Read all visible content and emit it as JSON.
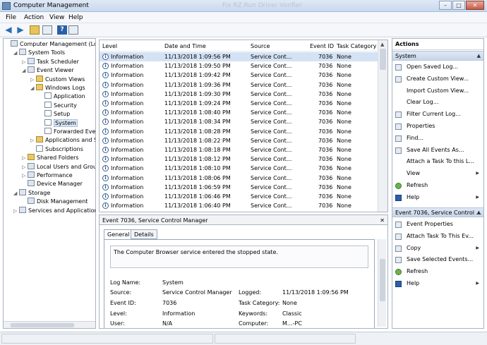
{
  "window": {
    "title": "Computer Management",
    "ghost_title": "Fix RZ Run Driver Verifier"
  },
  "menu": {
    "items": [
      "File",
      "Action",
      "View",
      "Help"
    ]
  },
  "tree": {
    "items": [
      {
        "label": "Computer Management (Local",
        "level": 0,
        "exp": "",
        "icon": "computer"
      },
      {
        "label": "System Tools",
        "level": 1,
        "exp": "◢",
        "icon": "tools"
      },
      {
        "label": "Task Scheduler",
        "level": 2,
        "exp": "▷",
        "icon": "clock"
      },
      {
        "label": "Event Viewer",
        "level": 2,
        "exp": "◢",
        "icon": "viewer"
      },
      {
        "label": "Custom Views",
        "level": 3,
        "exp": "▷",
        "icon": "folder"
      },
      {
        "label": "Windows Logs",
        "level": 3,
        "exp": "◢",
        "icon": "folder"
      },
      {
        "label": "Application",
        "level": 4,
        "exp": "",
        "icon": "log"
      },
      {
        "label": "Security",
        "level": 4,
        "exp": "",
        "icon": "log"
      },
      {
        "label": "Setup",
        "level": 4,
        "exp": "",
        "icon": "log"
      },
      {
        "label": "System",
        "level": 4,
        "exp": "",
        "icon": "log",
        "selected": true
      },
      {
        "label": "Forwarded Event",
        "level": 4,
        "exp": "",
        "icon": "log"
      },
      {
        "label": "Applications and Se",
        "level": 3,
        "exp": "▷",
        "icon": "folder"
      },
      {
        "label": "Subscriptions",
        "level": 3,
        "exp": "",
        "icon": "log"
      },
      {
        "label": "Shared Folders",
        "level": 2,
        "exp": "▷",
        "icon": "folder"
      },
      {
        "label": "Local Users and Groups",
        "level": 2,
        "exp": "▷",
        "icon": "users"
      },
      {
        "label": "Performance",
        "level": 2,
        "exp": "▷",
        "icon": "perf"
      },
      {
        "label": "Device Manager",
        "level": 2,
        "exp": "",
        "icon": "device"
      },
      {
        "label": "Storage",
        "level": 1,
        "exp": "◢",
        "icon": "storage"
      },
      {
        "label": "Disk Management",
        "level": 2,
        "exp": "",
        "icon": "disk"
      },
      {
        "label": "Services and Applications",
        "level": 1,
        "exp": "▷",
        "icon": "services"
      }
    ]
  },
  "events": {
    "columns": [
      "Level",
      "Date and Time",
      "Source",
      "Event ID",
      "Task Category"
    ],
    "rows": [
      {
        "level": "Information",
        "datetime": "11/13/2018 1:09:56 PM",
        "source": "Service Cont...",
        "id": "7036",
        "cat": "None",
        "selected": true
      },
      {
        "level": "Information",
        "datetime": "11/13/2018 1:09:50 PM",
        "source": "Service Cont...",
        "id": "7036",
        "cat": "None"
      },
      {
        "level": "Information",
        "datetime": "11/13/2018 1:09:42 PM",
        "source": "Service Cont...",
        "id": "7036",
        "cat": "None"
      },
      {
        "level": "Information",
        "datetime": "11/13/2018 1:09:36 PM",
        "source": "Service Cont...",
        "id": "7036",
        "cat": "None"
      },
      {
        "level": "Information",
        "datetime": "11/13/2018 1:09:30 PM",
        "source": "Service Cont...",
        "id": "7036",
        "cat": "None"
      },
      {
        "level": "Information",
        "datetime": "11/13/2018 1:09:24 PM",
        "source": "Service Cont...",
        "id": "7036",
        "cat": "None"
      },
      {
        "level": "Information",
        "datetime": "11/13/2018 1:08:40 PM",
        "source": "Service Cont...",
        "id": "7036",
        "cat": "None"
      },
      {
        "level": "Information",
        "datetime": "11/13/2018 1:08:34 PM",
        "source": "Service Cont...",
        "id": "7036",
        "cat": "None"
      },
      {
        "level": "Information",
        "datetime": "11/13/2018 1:08:28 PM",
        "source": "Service Cont...",
        "id": "7036",
        "cat": "None"
      },
      {
        "level": "Information",
        "datetime": "11/13/2018 1:08:22 PM",
        "source": "Service Cont...",
        "id": "7036",
        "cat": "None"
      },
      {
        "level": "Information",
        "datetime": "11/13/2018 1:08:18 PM",
        "source": "Service Cont...",
        "id": "7036",
        "cat": "None"
      },
      {
        "level": "Information",
        "datetime": "11/13/2018 1:08:12 PM",
        "source": "Service Cont...",
        "id": "7036",
        "cat": "None"
      },
      {
        "level": "Information",
        "datetime": "11/13/2018 1:08:10 PM",
        "source": "Service Cont...",
        "id": "7036",
        "cat": "None"
      },
      {
        "level": "Information",
        "datetime": "11/13/2018 1:08:06 PM",
        "source": "Service Cont...",
        "id": "7036",
        "cat": "None"
      },
      {
        "level": "Information",
        "datetime": "11/13/2018 1:06:59 PM",
        "source": "Service Cont...",
        "id": "7036",
        "cat": "None"
      },
      {
        "level": "Information",
        "datetime": "11/13/2018 1:06:46 PM",
        "source": "Service Cont...",
        "id": "7036",
        "cat": "None"
      },
      {
        "level": "Information",
        "datetime": "11/13/2018 1:06:40 PM",
        "source": "Service Cont...",
        "id": "7036",
        "cat": "None"
      }
    ]
  },
  "detail": {
    "header": "Event 7036, Service Control Manager",
    "tabs": [
      "General",
      "Details"
    ],
    "message": "The Computer Browser service entered the stopped state.",
    "fields": {
      "log_name_label": "Log Name:",
      "log_name": "System",
      "source_label": "Source:",
      "source": "Service Control Manager",
      "logged_label": "Logged:",
      "logged": "11/13/2018 1:09:56 PM",
      "event_id_label": "Event ID:",
      "event_id": "7036",
      "task_cat_label": "Task Category:",
      "task_cat": "None",
      "level_label": "Level:",
      "level": "Information",
      "keywords_label": "Keywords:",
      "keywords": "Classic",
      "user_label": "User:",
      "user": "N/A",
      "computer_label": "Computer:",
      "computer": "M...-PC"
    }
  },
  "actions": {
    "title": "Actions",
    "section1": "System",
    "items1": [
      {
        "label": "Open Saved Log...",
        "icon": "open"
      },
      {
        "label": "Create Custom View...",
        "icon": "filter"
      },
      {
        "label": "Import Custom View...",
        "icon": "none"
      },
      {
        "label": "Clear Log...",
        "icon": "none"
      },
      {
        "label": "Filter Current Log...",
        "icon": "filter"
      },
      {
        "label": "Properties",
        "icon": "props"
      },
      {
        "label": "Find...",
        "icon": "find"
      },
      {
        "label": "Save All Events As...",
        "icon": "save"
      },
      {
        "label": "Attach a Task To this L...",
        "icon": "none"
      },
      {
        "label": "View",
        "icon": "none",
        "sub": true
      },
      {
        "label": "Refresh",
        "icon": "green"
      },
      {
        "label": "Help",
        "icon": "blue",
        "sub": true
      }
    ],
    "section2": "Event 7036, Service Control ...",
    "items2": [
      {
        "label": "Event Properties",
        "icon": "props"
      },
      {
        "label": "Attach Task To This Ev...",
        "icon": "task"
      },
      {
        "label": "Copy",
        "icon": "copy",
        "sub": true
      },
      {
        "label": "Save Selected Events...",
        "icon": "save"
      },
      {
        "label": "Refresh",
        "icon": "green"
      },
      {
        "label": "Help",
        "icon": "blue",
        "sub": true
      }
    ]
  }
}
